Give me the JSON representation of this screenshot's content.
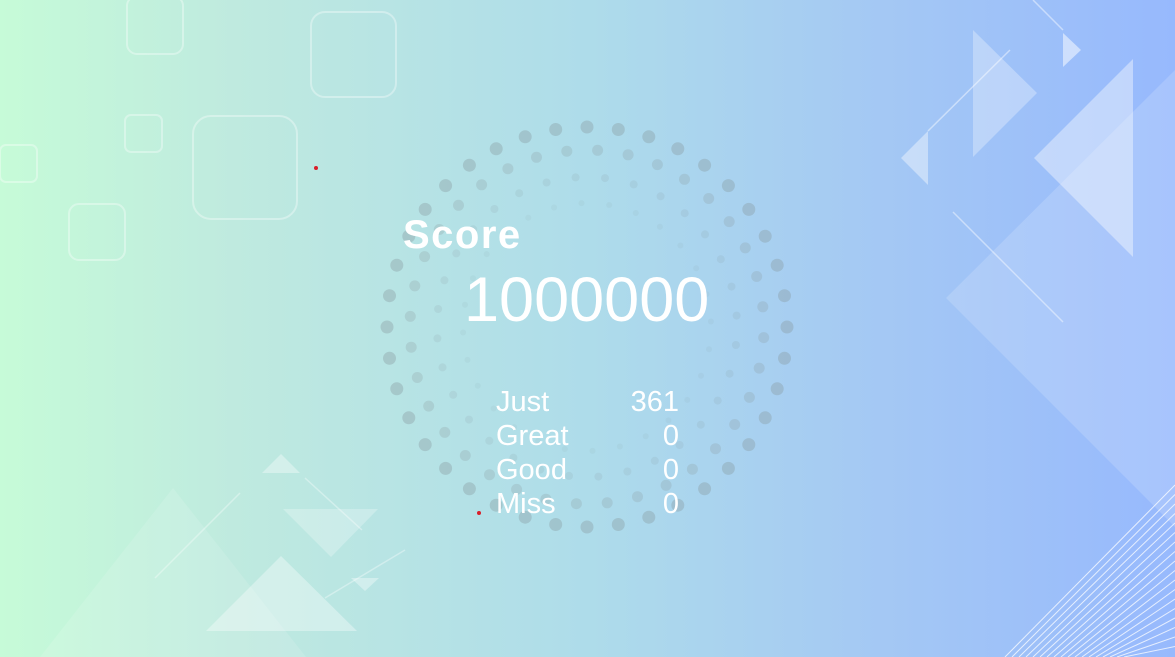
{
  "result": {
    "score_label": "Score",
    "score_value": "1000000",
    "judgements": [
      {
        "label": "Just",
        "value": "361"
      },
      {
        "label": "Great",
        "value": "0"
      },
      {
        "label": "Good",
        "value": "0"
      },
      {
        "label": "Miss",
        "value": "0"
      }
    ]
  },
  "colors": {
    "gradient_left": "#c6fbd8",
    "gradient_mid": "#aedcea",
    "gradient_right": "#97b9fd",
    "text": "#ffffff",
    "dot_ring": "#8a9aa0",
    "marker": "#d81f2a"
  }
}
